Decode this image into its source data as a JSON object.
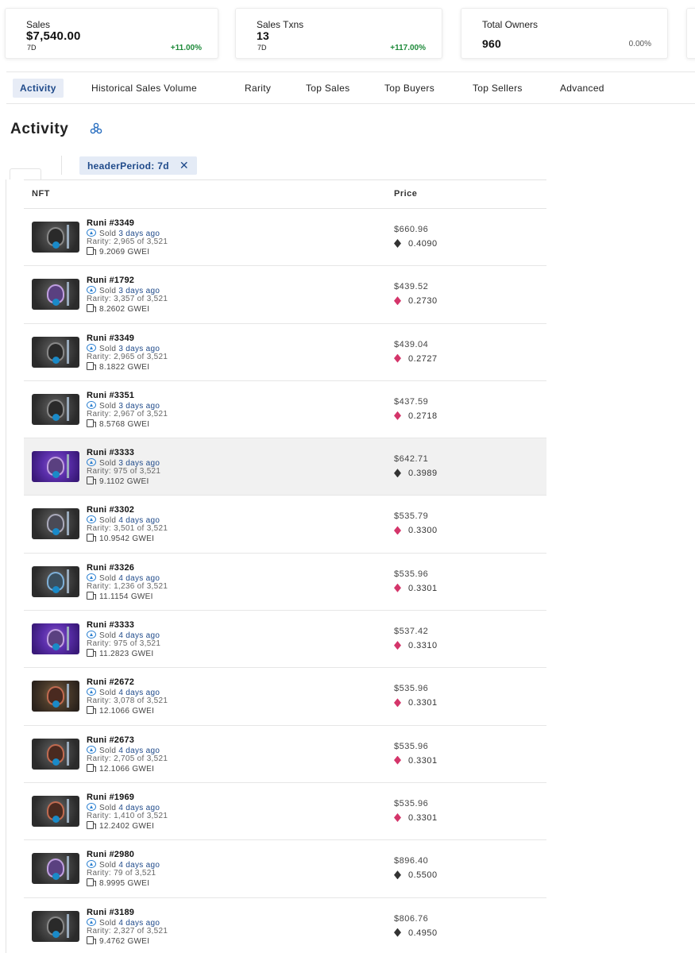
{
  "stats": [
    {
      "label": "Sales",
      "value": "$7,540.00",
      "period": "7D",
      "change": "+11.00%"
    },
    {
      "label": "Sales Txns",
      "value": "13",
      "period": "7D",
      "change": "+117.00%"
    },
    {
      "label": "Total Owners",
      "value": "960",
      "period": "",
      "change": "0.00%"
    }
  ],
  "tabs": [
    "Activity",
    "Historical Sales Volume",
    "Rarity",
    "Top Sales",
    "Top Buyers",
    "Top Sellers",
    "Advanced"
  ],
  "section": {
    "title": "Activity"
  },
  "filter": {
    "chip": "headerPeriod: 7d"
  },
  "table": {
    "col_nft": "NFT",
    "col_price": "Price"
  },
  "sold_prefix": "Sold",
  "rows": [
    {
      "name": "Runi #3349",
      "ago": "3 days ago",
      "rarity": "Rarity: 2,965 of 3,521",
      "gas": "9.2069 GWEI",
      "usd": "$660.96",
      "eth": "0.4090",
      "token": "eth",
      "thumb": "dark"
    },
    {
      "name": "Runi #1792",
      "ago": "3 days ago",
      "rarity": "Rarity: 3,357 of 3,521",
      "gas": "8.2602 GWEI",
      "usd": "$439.52",
      "eth": "0.2730",
      "token": "weth",
      "thumb": "violet"
    },
    {
      "name": "Runi #3349",
      "ago": "3 days ago",
      "rarity": "Rarity: 2,965 of 3,521",
      "gas": "8.1822 GWEI",
      "usd": "$439.04",
      "eth": "0.2727",
      "token": "weth",
      "thumb": "dark"
    },
    {
      "name": "Runi #3351",
      "ago": "3 days ago",
      "rarity": "Rarity: 2,967 of 3,521",
      "gas": "8.5768 GWEI",
      "usd": "$437.59",
      "eth": "0.2718",
      "token": "weth",
      "thumb": "dark"
    },
    {
      "name": "Runi #3333",
      "ago": "3 days ago",
      "rarity": "Rarity: 975 of 3,521",
      "gas": "9.1102 GWEI",
      "usd": "$642.71",
      "eth": "0.3989",
      "token": "eth",
      "thumb": "purple"
    },
    {
      "name": "Runi #3302",
      "ago": "4 days ago",
      "rarity": "Rarity: 3,501 of 3,521",
      "gas": "10.9542 GWEI",
      "usd": "$535.79",
      "eth": "0.3300",
      "token": "weth",
      "thumb": "slate"
    },
    {
      "name": "Runi #3326",
      "ago": "4 days ago",
      "rarity": "Rarity: 1,236 of 3,521",
      "gas": "11.1154 GWEI",
      "usd": "$535.96",
      "eth": "0.3301",
      "token": "weth",
      "thumb": "blue"
    },
    {
      "name": "Runi #3333",
      "ago": "4 days ago",
      "rarity": "Rarity: 975 of 3,521",
      "gas": "11.2823 GWEI",
      "usd": "$537.42",
      "eth": "0.3310",
      "token": "weth",
      "thumb": "purple"
    },
    {
      "name": "Runi #2672",
      "ago": "4 days ago",
      "rarity": "Rarity: 3,078 of 3,521",
      "gas": "12.1066 GWEI",
      "usd": "$535.96",
      "eth": "0.3301",
      "token": "weth",
      "thumb": "brown"
    },
    {
      "name": "Runi #2673",
      "ago": "4 days ago",
      "rarity": "Rarity: 2,705 of 3,521",
      "gas": "12.1066 GWEI",
      "usd": "$535.96",
      "eth": "0.3301",
      "token": "weth",
      "thumb": "red"
    },
    {
      "name": "Runi #1969",
      "ago": "4 days ago",
      "rarity": "Rarity: 1,410 of 3,521",
      "gas": "12.2402 GWEI",
      "usd": "$535.96",
      "eth": "0.3301",
      "token": "weth",
      "thumb": "red"
    },
    {
      "name": "Runi #2980",
      "ago": "4 days ago",
      "rarity": "Rarity: 79 of 3,521",
      "gas": "8.9995 GWEI",
      "usd": "$896.40",
      "eth": "0.5500",
      "token": "eth",
      "thumb": "violet"
    },
    {
      "name": "Runi #3189",
      "ago": "4 days ago",
      "rarity": "Rarity: 2,327 of 3,521",
      "gas": "9.4762 GWEI",
      "usd": "$806.76",
      "eth": "0.4950",
      "token": "eth",
      "thumb": "dark"
    }
  ],
  "colors": {
    "accent": "#1f4a8a",
    "positive": "#1e8a3a",
    "weth": "#d4356a",
    "eth": "#333333"
  },
  "icons": {
    "heading": "share-network-icon",
    "chip_close": "close-icon",
    "sold": "opensea-icon",
    "gas": "gas-pump-icon",
    "eth": "ethereum-icon",
    "weth": "weth-icon"
  }
}
